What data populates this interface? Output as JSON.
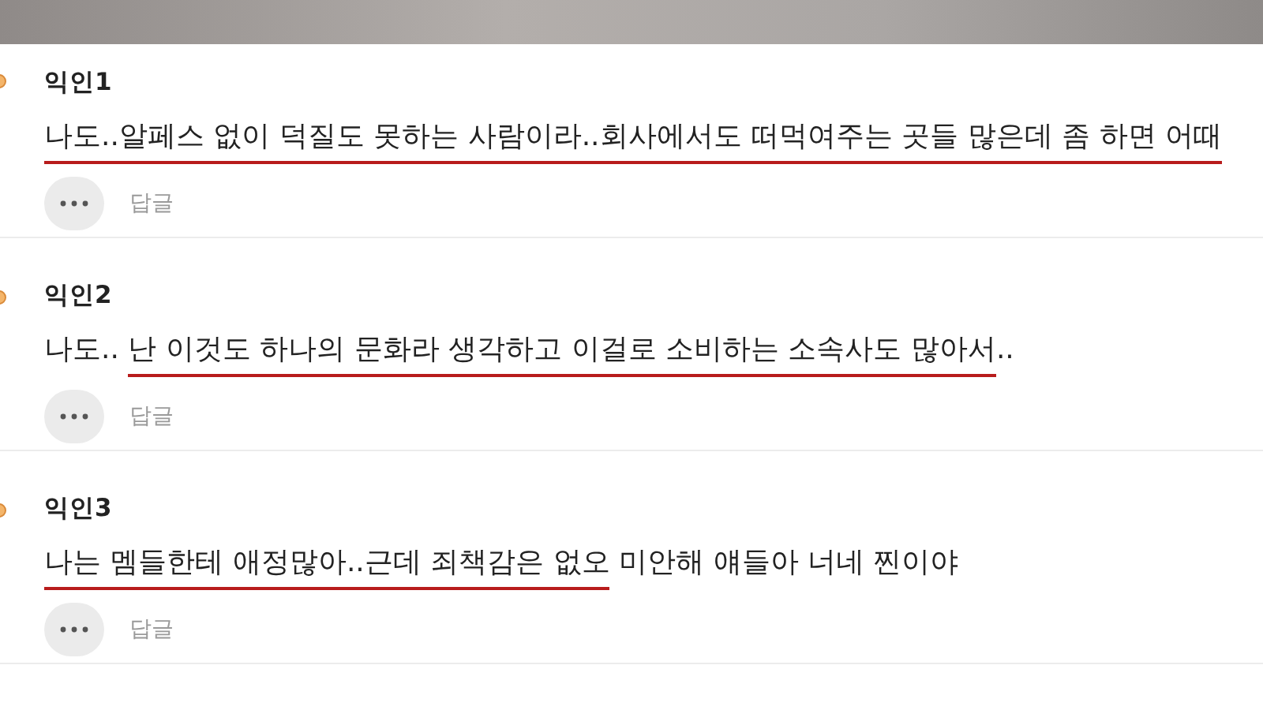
{
  "comments": [
    {
      "author": "익인1",
      "reply_label": "답글",
      "segments": [
        {
          "text": "나도..알페스 없이 덕질도 못하는 사람이라..회사에서도 떠먹여주는 곳들 많은데 좀 하면 어때",
          "underlined": true
        }
      ]
    },
    {
      "author": "익인2",
      "reply_label": "답글",
      "segments": [
        {
          "text": "나도.. ",
          "underlined": false
        },
        {
          "text": "난 이것도 하나의 문화라 생각하고 이걸로 소비하는 소속사도 많아서",
          "underlined": true
        },
        {
          "text": "..",
          "underlined": false
        }
      ]
    },
    {
      "author": "익인3",
      "reply_label": "답글",
      "segments": [
        {
          "text": "나는 멤들한테 애정많아..근데 죄책감은 없오",
          "underlined": true
        },
        {
          "text": " 미안해 얘들아 너네 찐이야",
          "underlined": false
        }
      ]
    }
  ]
}
